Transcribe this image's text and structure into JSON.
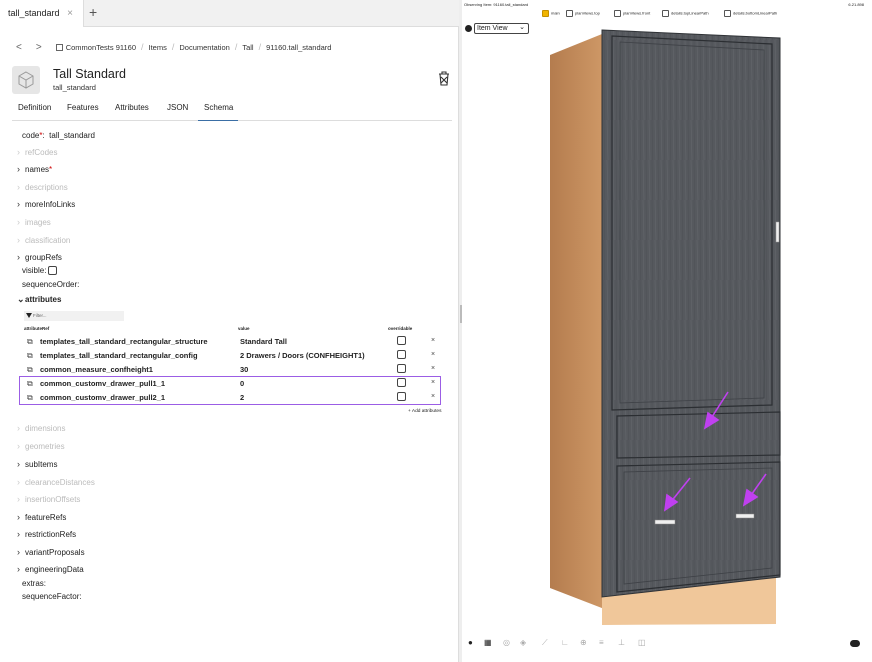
{
  "tab": {
    "label": "tall_standard",
    "close": "×",
    "new": "+"
  },
  "breadcrumb": {
    "back": "<",
    "forward": ">",
    "items": [
      "CommonTests 91160",
      "Items",
      "Documentation",
      "Tall",
      "91160.tall_standard"
    ]
  },
  "header": {
    "title": "Tall Standard",
    "code": "tall_standard"
  },
  "subtabs": [
    "Definition",
    "Features",
    "Attributes",
    "JSON",
    "Schema"
  ],
  "fields": {
    "code_label": "code",
    "code_value": "tall_standard",
    "refCodes": "refCodes",
    "names": "names",
    "descriptions": "descriptions",
    "moreInfoLinks": "moreInfoLinks",
    "images": "images",
    "classification": "classification",
    "groupRefs": "groupRefs",
    "visible": "visible:",
    "sequenceOrder": "sequenceOrder:",
    "attributes": "attributes",
    "dimensions": "dimensions",
    "geometries": "geometries",
    "subItems": "subItems",
    "clearanceDistances": "clearanceDistances",
    "insertionOffsets": "insertionOffsets",
    "featureRefs": "featureRefs",
    "restrictionRefs": "restrictionRefs",
    "variantProposals": "variantProposals",
    "engineeringData": "engineeringData",
    "extras": "extras:",
    "sequenceFactor": "sequenceFactor:"
  },
  "attributes_table": {
    "filter_placeholder": "Filter...",
    "headers": {
      "ref": "attributeRef",
      "value": "value",
      "overridable": "overridable"
    },
    "rows": [
      {
        "ref": "templates_tall_standard_rectangular_structure",
        "value": "Standard Tall"
      },
      {
        "ref": "templates_tall_standard_rectangular_config",
        "value": "2 Drawers / Doors (CONFHEIGHT1)"
      },
      {
        "ref": "common_measure_confheight1",
        "value": "30"
      },
      {
        "ref": "common_customv_drawer_pull1_1",
        "value": "0"
      },
      {
        "ref": "common_customv_drawer_pull2_1",
        "value": "2"
      }
    ],
    "add_label": "+ Add attributes",
    "delete_glyph": "×",
    "link_glyph": "⧉"
  },
  "viewer": {
    "observing": "Observing Item: 91160.tall_standard",
    "version": "6.21.898",
    "layers": [
      {
        "label": "main",
        "checked": true
      },
      {
        "label": "planViews.top",
        "checked": false
      },
      {
        "label": "planViews.front",
        "checked": false
      },
      {
        "label": "details.topLinearPath",
        "checked": false
      },
      {
        "label": "details.bottomLinearPath",
        "checked": false
      }
    ],
    "view_select": "Item View",
    "colors": {
      "accent": "#9b5de5",
      "door": "#55585d",
      "wood": "#c98f5e",
      "arrow": "#c040f0"
    }
  }
}
